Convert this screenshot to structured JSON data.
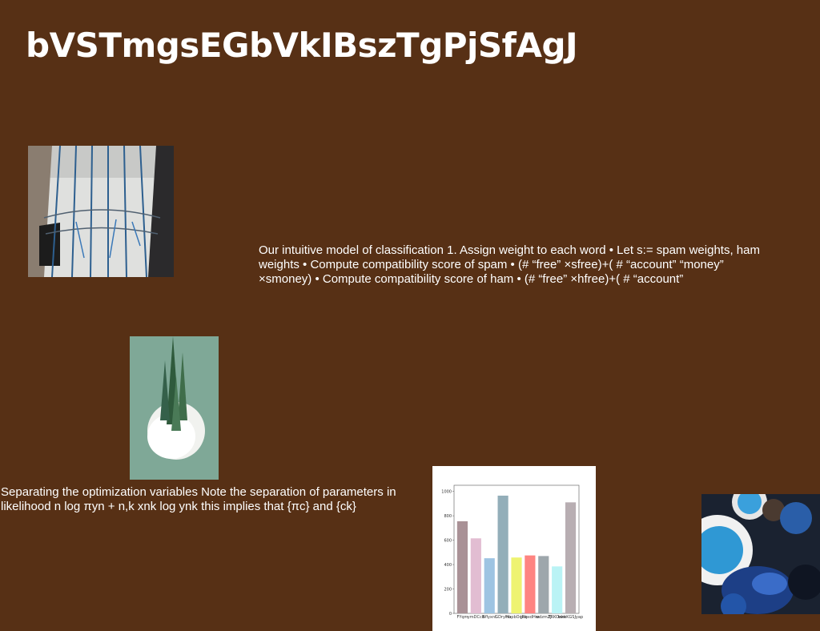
{
  "page": {
    "title": "bVSTmgsEGbVkIBszTgPjSfAgJ",
    "background": "#573015"
  },
  "text_blocks": {
    "classification": "Our intuitive model of classification 1. Assign weight to each word • Let s:= spam weights, ham weights • Compute compatibility score of spam • (# “free” ×sfree)+( # “account” “money” ×smoney) • Compute compatibility score of ham • (# “free” ×hfree)+( # “account”",
    "optimization": "Separating the optimization variables Note the separation of parameters in likelihood  n log πyn +  n,k xnk log ynk this implies that {πc} and {ck}"
  },
  "images": {
    "building": "building-interior-photo",
    "trees": "miniature-trees-snow-photo",
    "food": "blue-dessert-table-photo"
  },
  "chart_data": {
    "type": "bar",
    "categories": [
      "FYqm",
      "ymDCcb",
      "Bflyxnt",
      "GDryHu",
      "hbpbOqaq",
      "jPloxdHm",
      "wdzmZJ",
      "YRKOoko",
      "bwkKGSJyap"
    ],
    "values": [
      755,
      615,
      452,
      965,
      458,
      475,
      470,
      385,
      910
    ],
    "colors": [
      "#a99196",
      "#e2bdd2",
      "#9ec4e2",
      "#93aeb9",
      "#eef371",
      "#fe8481",
      "#9ea7ac",
      "#baf3f5",
      "#b8aeb2"
    ],
    "ylim": [
      0,
      1050
    ],
    "yticks": [
      0,
      200,
      400,
      600,
      800,
      1000
    ]
  }
}
